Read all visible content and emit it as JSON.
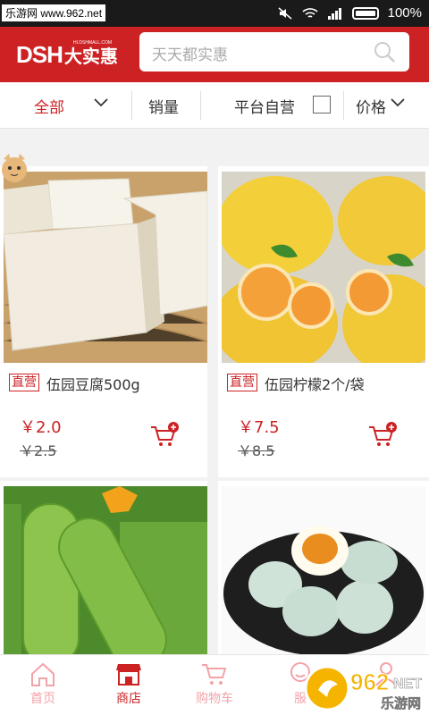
{
  "statusbar": {
    "watermark": "乐游网 www.962.net",
    "battery": "100%"
  },
  "header": {
    "logo_main": "DSH",
    "logo_cn": "大实惠",
    "logo_sub": "HI.DSHMALL.COM",
    "search_placeholder": "天天都实惠"
  },
  "filters": {
    "all": "全部",
    "sales": "销量",
    "self_operated": "平台自营",
    "price": "价格"
  },
  "products": [
    {
      "tag": "直营",
      "name": "伍园豆腐500g",
      "price": "￥2.0",
      "original_price": "￥2.5"
    },
    {
      "tag": "直营",
      "name": "伍园柠檬2个/袋",
      "price": "￥7.5",
      "original_price": "￥8.5"
    }
  ],
  "nav": {
    "home": "首页",
    "store": "商店",
    "cart": "购物车",
    "service": "服",
    "account": ""
  },
  "brand_logo": {
    "text": "962",
    "net": "NET",
    "cn": "乐游网"
  },
  "colors": {
    "accent": "#cc2224",
    "nav_inactive": "#f3a2a8"
  }
}
